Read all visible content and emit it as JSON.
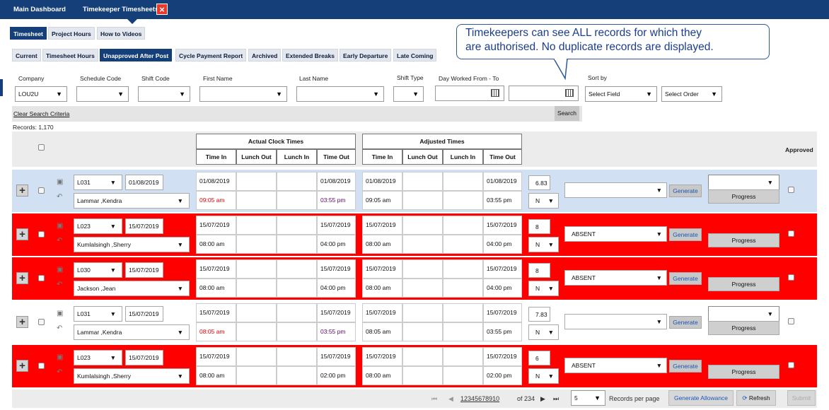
{
  "top_tabs": {
    "main": "Main Dashboard",
    "timesheets": "Timekeeper Timesheets",
    "close": "×"
  },
  "module_tabs": [
    "Timesheet",
    "Project Hours",
    "How to Videos"
  ],
  "sub_tabs": [
    "Current",
    "Timesheet Hours",
    "Unapproved After Post",
    "Cycle Payment Report",
    "Archived",
    "Extended Breaks",
    "Early Departure",
    "Late Coming"
  ],
  "callout": {
    "line1": "Timekeepers can see ALL records for which they",
    "line2": "are authorised.  No duplicate records are displayed."
  },
  "filters": {
    "company_label": "Company",
    "company_value": "LOU2U",
    "schedule_label": "Schedule Code",
    "shift_code_label": "Shift Code",
    "first_name_label": "First Name",
    "last_name_label": "Last Name",
    "shift_type_label": "Shift Type",
    "day_worked_label": "Day Worked From - To",
    "sort_by_label": "Sort by",
    "sort_field": "Select Field",
    "sort_order": "Select Order"
  },
  "search": {
    "clear": "Clear Search Criteria",
    "button": "Search",
    "records": "Records:  1,170"
  },
  "grid_headers": {
    "actual": "Actual Clock Times",
    "adjusted": "Adjusted Times",
    "time_in": "Time In",
    "lunch_out": "Lunch Out",
    "lunch_in": "Lunch In",
    "time_out": "Time Out",
    "approved": "Approved"
  },
  "rows": [
    {
      "code": "L031",
      "date": "01/08/2019",
      "name": "Lammar ,Kendra",
      "act_in_date": "01/08/2019",
      "act_out_date": "01/08/2019",
      "act_in": "09:05 am",
      "act_out": "03:55 pm",
      "adj_in_date": "01/08/2019",
      "adj_out_date": "01/08/2019",
      "adj_in": "09:05 am",
      "adj_out": "03:55 pm",
      "hours": "6.83",
      "flag": "N",
      "reason": "",
      "generate": "Generate",
      "progress": "Progress",
      "bg": "#d2e0f4",
      "in_class": "red",
      "out_class": "purple"
    },
    {
      "code": "L023",
      "date": "15/07/2019",
      "name": "Kumlalsingh ,Sherry",
      "act_in_date": "15/07/2019",
      "act_out_date": "15/07/2019",
      "act_in": "08:00 am",
      "act_out": "04:00 pm",
      "adj_in_date": "15/07/2019",
      "adj_out_date": "15/07/2019",
      "adj_in": "08:00 am",
      "adj_out": "04:00 pm",
      "hours": "8",
      "flag": "N",
      "reason": "ABSENT",
      "generate": "Generate",
      "progress": "Progress",
      "bg": "#ff0000",
      "in_class": "",
      "out_class": ""
    },
    {
      "code": "L030",
      "date": "15/07/2019",
      "name": "Jackson ,Jean",
      "act_in_date": "15/07/2019",
      "act_out_date": "15/07/2019",
      "act_in": "08:00 am",
      "act_out": "04:00 pm",
      "adj_in_date": "15/07/2019",
      "adj_out_date": "15/07/2019",
      "adj_in": "08:00 am",
      "adj_out": "04:00 pm",
      "hours": "8",
      "flag": "N",
      "reason": "ABSENT",
      "generate": "Generate",
      "progress": "Progress",
      "bg": "#ff0000",
      "in_class": "",
      "out_class": ""
    },
    {
      "code": "L031",
      "date": "15/07/2019",
      "name": "Lammar ,Kendra",
      "act_in_date": "15/07/2019",
      "act_out_date": "15/07/2019",
      "act_in": "08:05 am",
      "act_out": "03:55 pm",
      "adj_in_date": "15/07/2019",
      "adj_out_date": "15/07/2019",
      "adj_in": "08:05 am",
      "adj_out": "03:55 pm",
      "hours": "7.83",
      "flag": "N",
      "reason": "",
      "generate": "Generate",
      "progress": "Progress",
      "bg": "#ffffff",
      "in_class": "red",
      "out_class": "purple"
    },
    {
      "code": "L023",
      "date": "15/07/2019",
      "name": "Kumlalsingh ,Sherry",
      "act_in_date": "15/07/2019",
      "act_out_date": "15/07/2019",
      "act_in": "08:00 am",
      "act_out": "02:00 pm",
      "adj_in_date": "15/07/2019",
      "adj_out_date": "15/07/2019",
      "adj_in": "08:00 am",
      "adj_out": "02:00 pm",
      "hours": "6",
      "flag": "N",
      "reason": "ABSENT",
      "generate": "Generate",
      "progress": "Progress",
      "bg": "#ff0000",
      "in_class": "",
      "out_class": ""
    }
  ],
  "pager": {
    "pages": [
      "1",
      "2",
      "3",
      "4",
      "5",
      "6",
      "7",
      "8",
      "9",
      "10"
    ],
    "of_text": "of 234",
    "page_size": "5",
    "per_page_label": "Records per page",
    "generate_allowance": "Generate Allowance",
    "refresh": "Refresh",
    "submit": "Submit"
  }
}
